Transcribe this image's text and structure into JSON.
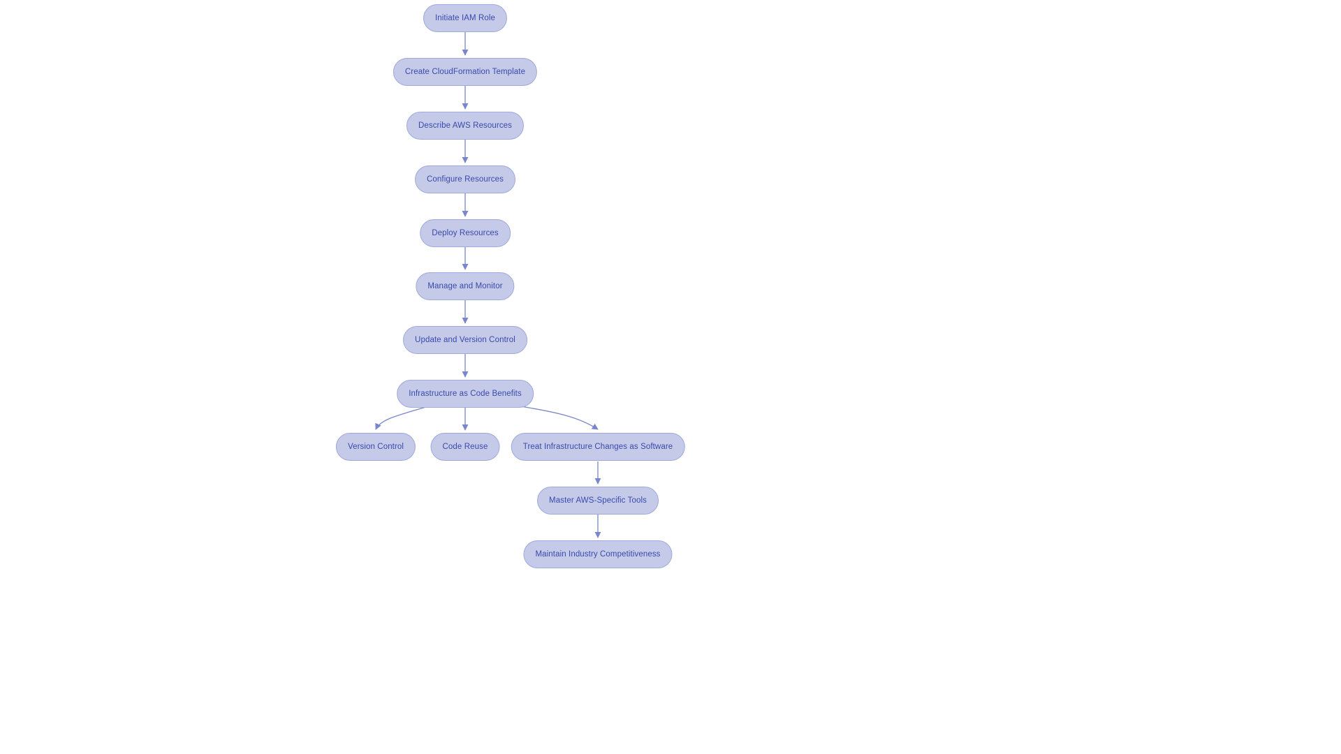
{
  "nodes": {
    "n1": {
      "label": "Initiate IAM Role"
    },
    "n2": {
      "label": "Create CloudFormation Template"
    },
    "n3": {
      "label": "Describe AWS Resources"
    },
    "n4": {
      "label": "Configure Resources"
    },
    "n5": {
      "label": "Deploy Resources"
    },
    "n6": {
      "label": "Manage and Monitor"
    },
    "n7": {
      "label": "Update and Version Control"
    },
    "n8": {
      "label": "Infrastructure as Code Benefits"
    },
    "n9": {
      "label": "Version Control"
    },
    "n10": {
      "label": "Code Reuse"
    },
    "n11": {
      "label": "Treat Infrastructure Changes as Software"
    },
    "n12": {
      "label": "Master AWS-Specific Tools"
    },
    "n13": {
      "label": "Maintain Industry Competitiveness"
    }
  },
  "colors": {
    "node_fill": "#c5cae9",
    "node_stroke": "#9fa8da",
    "node_text": "#3949ab",
    "edge": "#7986cb"
  }
}
